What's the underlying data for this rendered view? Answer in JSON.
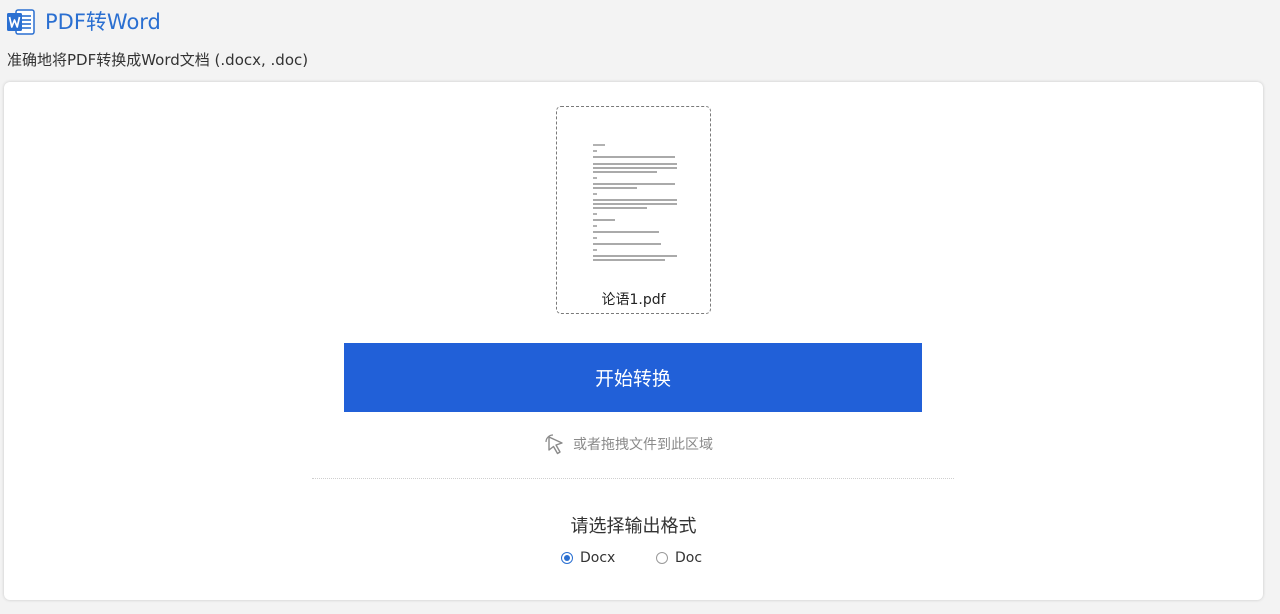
{
  "app": {
    "title": "PDF转Word",
    "subtitle": "准确地将PDF转换成Word文档 (.docx, .doc)",
    "accent_color": "#2a6fd1",
    "logo_icon": "word-icon"
  },
  "file": {
    "name": "论语1.pdf",
    "icon": "document-thumbnail"
  },
  "actions": {
    "convert_label": "开始转换",
    "convert_color": "#2160d8",
    "drag_hint": "或者拖拽文件到此区域",
    "drag_icon": "pointer-click-icon"
  },
  "output": {
    "title": "请选择输出格式",
    "options": [
      {
        "label": "Docx",
        "selected": true
      },
      {
        "label": "Doc",
        "selected": false
      }
    ]
  }
}
